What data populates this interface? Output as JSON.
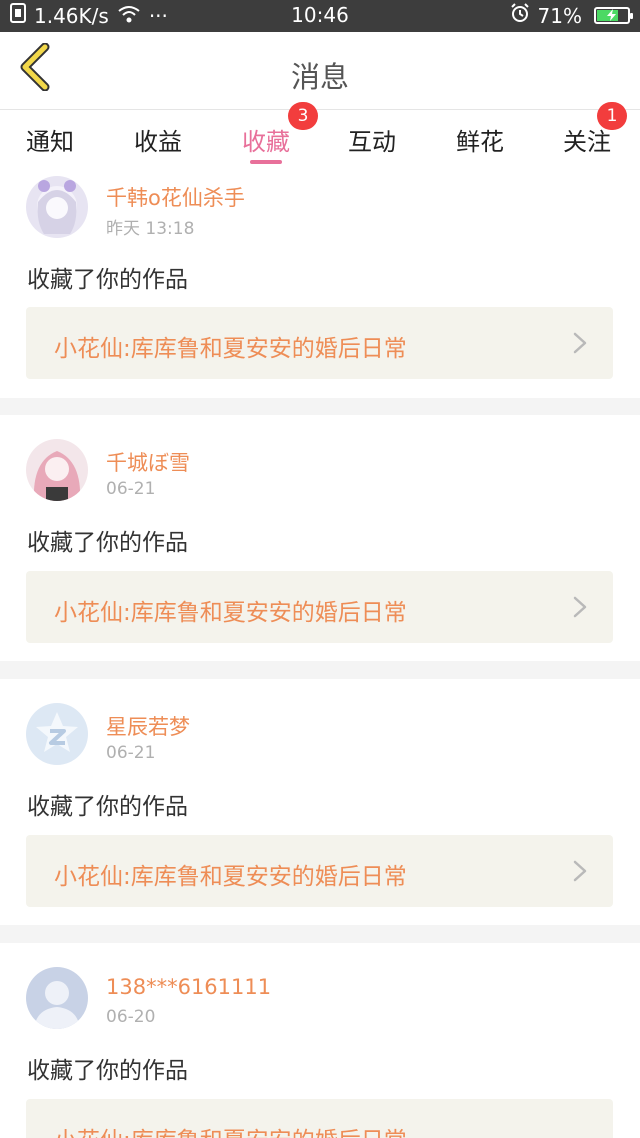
{
  "status_bar": {
    "network_speed": "1.46K/s",
    "more": "···",
    "time": "10:46",
    "battery": "71%",
    "battery_level": 0.71,
    "icons": [
      "sim-icon",
      "wifi-icon",
      "alarm-icon",
      "battery-charging-icon"
    ]
  },
  "header": {
    "title": "消息",
    "back_icon": "back-chevron-icon",
    "accent": "#f2d84a"
  },
  "tabs": [
    {
      "label": "通知",
      "badge": ""
    },
    {
      "label": "收益",
      "badge": ""
    },
    {
      "label": "收藏",
      "badge": "3",
      "active": true
    },
    {
      "label": "互动",
      "badge": ""
    },
    {
      "label": "鲜花",
      "badge": ""
    },
    {
      "label": "关注",
      "badge": "1"
    }
  ],
  "colors": {
    "active_tab": "#e8709a",
    "username": "#ee8d56",
    "badge": "#f23d3d",
    "work_bg": "#f4f3ec"
  },
  "notifications": [
    {
      "user": "千韩o花仙杀手",
      "time": "昨天 13:18",
      "action": "收藏了你的作品",
      "work": "小花仙:库库鲁和夏安安的婚后日常",
      "avatar": "anime-avatar-white"
    },
    {
      "user": "千城ぼ雪",
      "time": "06-21",
      "action": "收藏了你的作品",
      "work": "小花仙:库库鲁和夏安安的婚后日常",
      "avatar": "anime-avatar-pink"
    },
    {
      "user": "星辰若梦",
      "time": "06-21",
      "action": "收藏了你的作品",
      "work": "小花仙:库库鲁和夏安安的婚后日常",
      "avatar": "qq-star-avatar"
    },
    {
      "user": "138***6161111",
      "time": "06-20",
      "action": "收藏了你的作品",
      "work": "小花仙:库库鲁和夏安安的婚后日常",
      "avatar": "default-person-avatar"
    }
  ]
}
